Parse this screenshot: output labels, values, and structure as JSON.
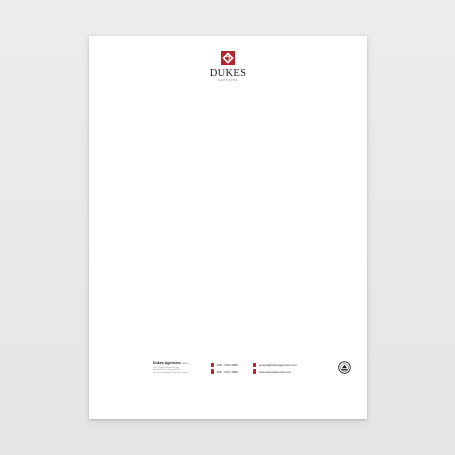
{
  "letterhead": {
    "brand": "DUKES",
    "brand_sub": "AGENCIES",
    "accent_color": "#b5262c",
    "logo_icon": "diamond-emblem-icon",
    "seal_icon": "certification-seal-icon"
  },
  "footer": {
    "company_name": "Dukes Agencies",
    "company_reg": "LIMITED",
    "address_lines": [
      "Unit 4 Dukes Business Park",
      "Dukes Road, Coleraine BT52",
      "County Londonderry, Northern Ireland"
    ],
    "phones": [
      "028 - 7033 2589",
      "028 - 7021 2589"
    ],
    "web": [
      "general@dukesagencies.com",
      "www.dukesagencies.com"
    ]
  }
}
